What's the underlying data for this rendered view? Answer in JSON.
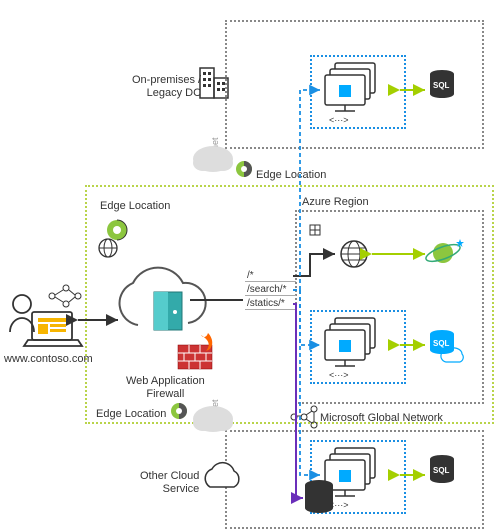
{
  "labels": {
    "onprem": "On-premises /\nLegacy DC",
    "edge_top": "Edge Location",
    "edge_left": "Edge Location",
    "edge_bottom": "Edge Location",
    "azure_region": "Azure Region",
    "waf": "Web Application\nFirewall",
    "mgn": "Microsoft Global Network",
    "other_cloud": "Other Cloud\nService",
    "url": "www.contoso.com",
    "internet1": "Internet",
    "internet2": "Internet"
  },
  "routes": {
    "root": "/*",
    "search": "/search/*",
    "statics": "/statics/*"
  }
}
